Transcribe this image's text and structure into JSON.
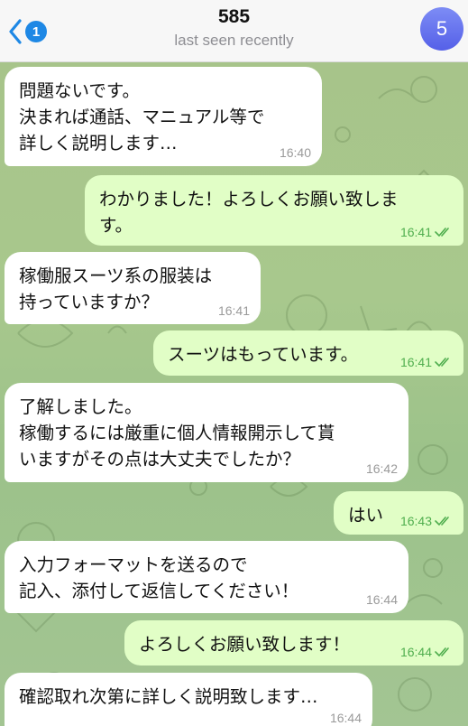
{
  "header": {
    "back_badge": "1",
    "title": "585",
    "status": "last seen recently",
    "avatar_initial": "5"
  },
  "colors": {
    "accent": "#1e88e5",
    "incoming_bubble": "#ffffff",
    "outgoing_bubble": "#e1fec6",
    "read_tick": "#4fae4e"
  },
  "messages": [
    {
      "direction": "in",
      "text": "問題ないです。\n決まれば通話、マニュアル等で\n詳しく説明します…",
      "time": "16:40"
    },
    {
      "direction": "out",
      "text": "わかりました！よろしくお願い致しま\nす。",
      "time": "16:41",
      "status": "read"
    },
    {
      "direction": "in",
      "text": "稼働服スーツ系の服装は\n持っていますか？",
      "time": "16:41"
    },
    {
      "direction": "out",
      "text": "スーツはもっています。",
      "time": "16:41",
      "status": "read"
    },
    {
      "direction": "in",
      "text": "了解しました。\n稼働するには厳重に個人情報開示して貰\nいますがその点は大丈夫でしたか？",
      "time": "16:42"
    },
    {
      "direction": "out",
      "text": "はい",
      "time": "16:43",
      "status": "read"
    },
    {
      "direction": "in",
      "text": "入力フォーマットを送るので\n記入、添付して返信してください！",
      "time": "16:44"
    },
    {
      "direction": "out",
      "text": "よろしくお願い致します！",
      "time": "16:44",
      "status": "read"
    },
    {
      "direction": "in",
      "text": "確認取れ次第に詳しく説明致します…",
      "time": "16:44"
    }
  ]
}
